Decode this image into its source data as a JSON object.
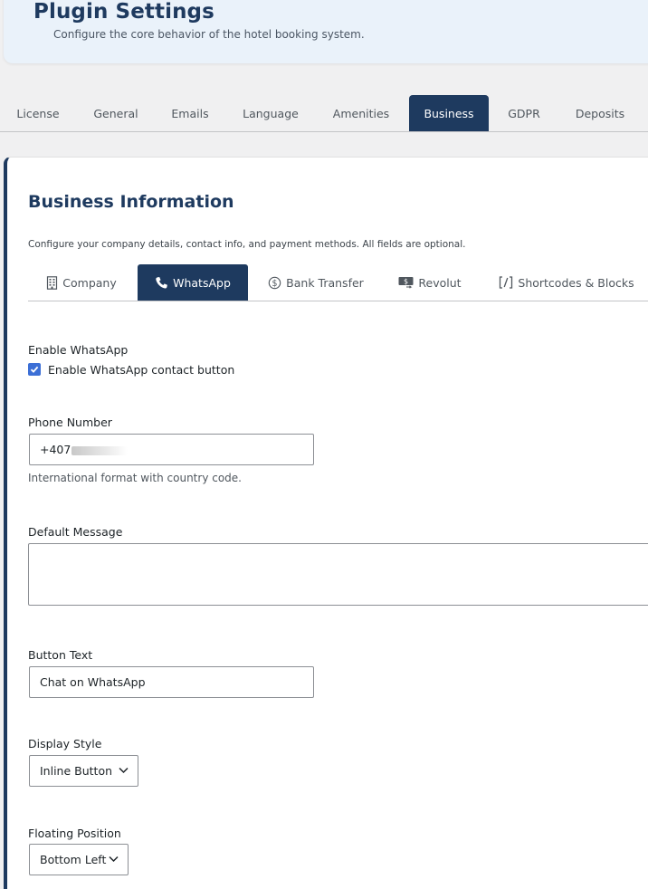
{
  "header": {
    "title": "Plugin Settings",
    "subtitle": "Configure the core behavior of the hotel booking system."
  },
  "main_tabs": [
    {
      "label": "License",
      "active": false
    },
    {
      "label": "General",
      "active": false
    },
    {
      "label": "Emails",
      "active": false
    },
    {
      "label": "Language",
      "active": false
    },
    {
      "label": "Amenities",
      "active": false
    },
    {
      "label": "Business",
      "active": true
    },
    {
      "label": "GDPR",
      "active": false
    },
    {
      "label": "Deposits",
      "active": false
    }
  ],
  "section": {
    "title": "Business Information",
    "description": "Configure your company details, contact info, and payment methods. All fields are optional."
  },
  "sub_tabs": [
    {
      "label": "Company",
      "icon": "building-icon",
      "active": false
    },
    {
      "label": "WhatsApp",
      "icon": "phone-icon",
      "active": true
    },
    {
      "label": "Bank Transfer",
      "icon": "dollar-icon",
      "active": false
    },
    {
      "label": "Revolut",
      "icon": "money-transfer-icon",
      "active": false
    },
    {
      "label": "Shortcodes & Blocks",
      "icon": "shortcode-icon",
      "active": false
    }
  ],
  "form": {
    "enable_label": "Enable WhatsApp",
    "enable_checkbox_label": "Enable WhatsApp contact button",
    "enable_checked": true,
    "phone_label": "Phone Number",
    "phone_value": "+407",
    "phone_help": "International format with country code.",
    "message_label": "Default Message",
    "message_value": "",
    "button_text_label": "Button Text",
    "button_text_value": "Chat on WhatsApp",
    "display_style_label": "Display Style",
    "display_style_value": "Inline Button",
    "floating_position_label": "Floating Position",
    "floating_position_value": "Bottom Left"
  },
  "colors": {
    "accent": "#1e3a5f",
    "checkbox": "#3c6fd6",
    "header_bg": "#eaf2fa"
  }
}
